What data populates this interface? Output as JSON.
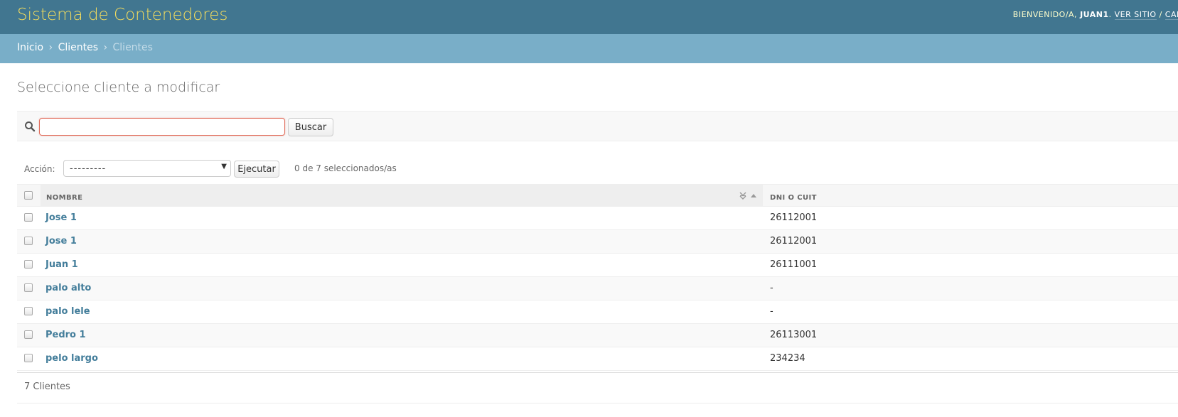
{
  "header": {
    "site_title": "Sistema de Contenedores",
    "welcome": "Bienvenido/a,",
    "username": "juan1",
    "view_site": "Ver sitio",
    "sep": " / ",
    "change_password": "Cam"
  },
  "breadcrumbs": {
    "home": "Inicio",
    "app": "Clientes",
    "current": "Clientes",
    "separator": "›"
  },
  "content": {
    "title": "Seleccione cliente a modificar"
  },
  "search": {
    "value": "",
    "placeholder": "",
    "button_label": "Buscar"
  },
  "actions": {
    "label": "Acción:",
    "selected_option": "---------",
    "go_label": "Ejecutar",
    "counter": "0 de 7 seleccionados/as"
  },
  "table": {
    "headers": [
      "Nombre",
      "DNI o CUIT"
    ],
    "rows": [
      {
        "name": "Jose 1",
        "dni": "26112001"
      },
      {
        "name": "Jose 1",
        "dni": "26112001"
      },
      {
        "name": "Juan 1",
        "dni": "26111001"
      },
      {
        "name": "palo alto",
        "dni": "-"
      },
      {
        "name": "palo lele",
        "dni": "-"
      },
      {
        "name": "Pedro 1",
        "dni": "26113001"
      },
      {
        "name": "pelo largo",
        "dni": "234234"
      }
    ]
  },
  "paginator": {
    "text": "7 Clientes"
  },
  "colors": {
    "header_bg": "#417690",
    "title_yellow": "#f5dd5d",
    "breadcrumb_bg": "#79aec8",
    "link": "#447e9b"
  },
  "icons": {
    "search": "search-icon",
    "sort": "sort-toggle-icon",
    "dropdown": "chevron-down-icon"
  }
}
